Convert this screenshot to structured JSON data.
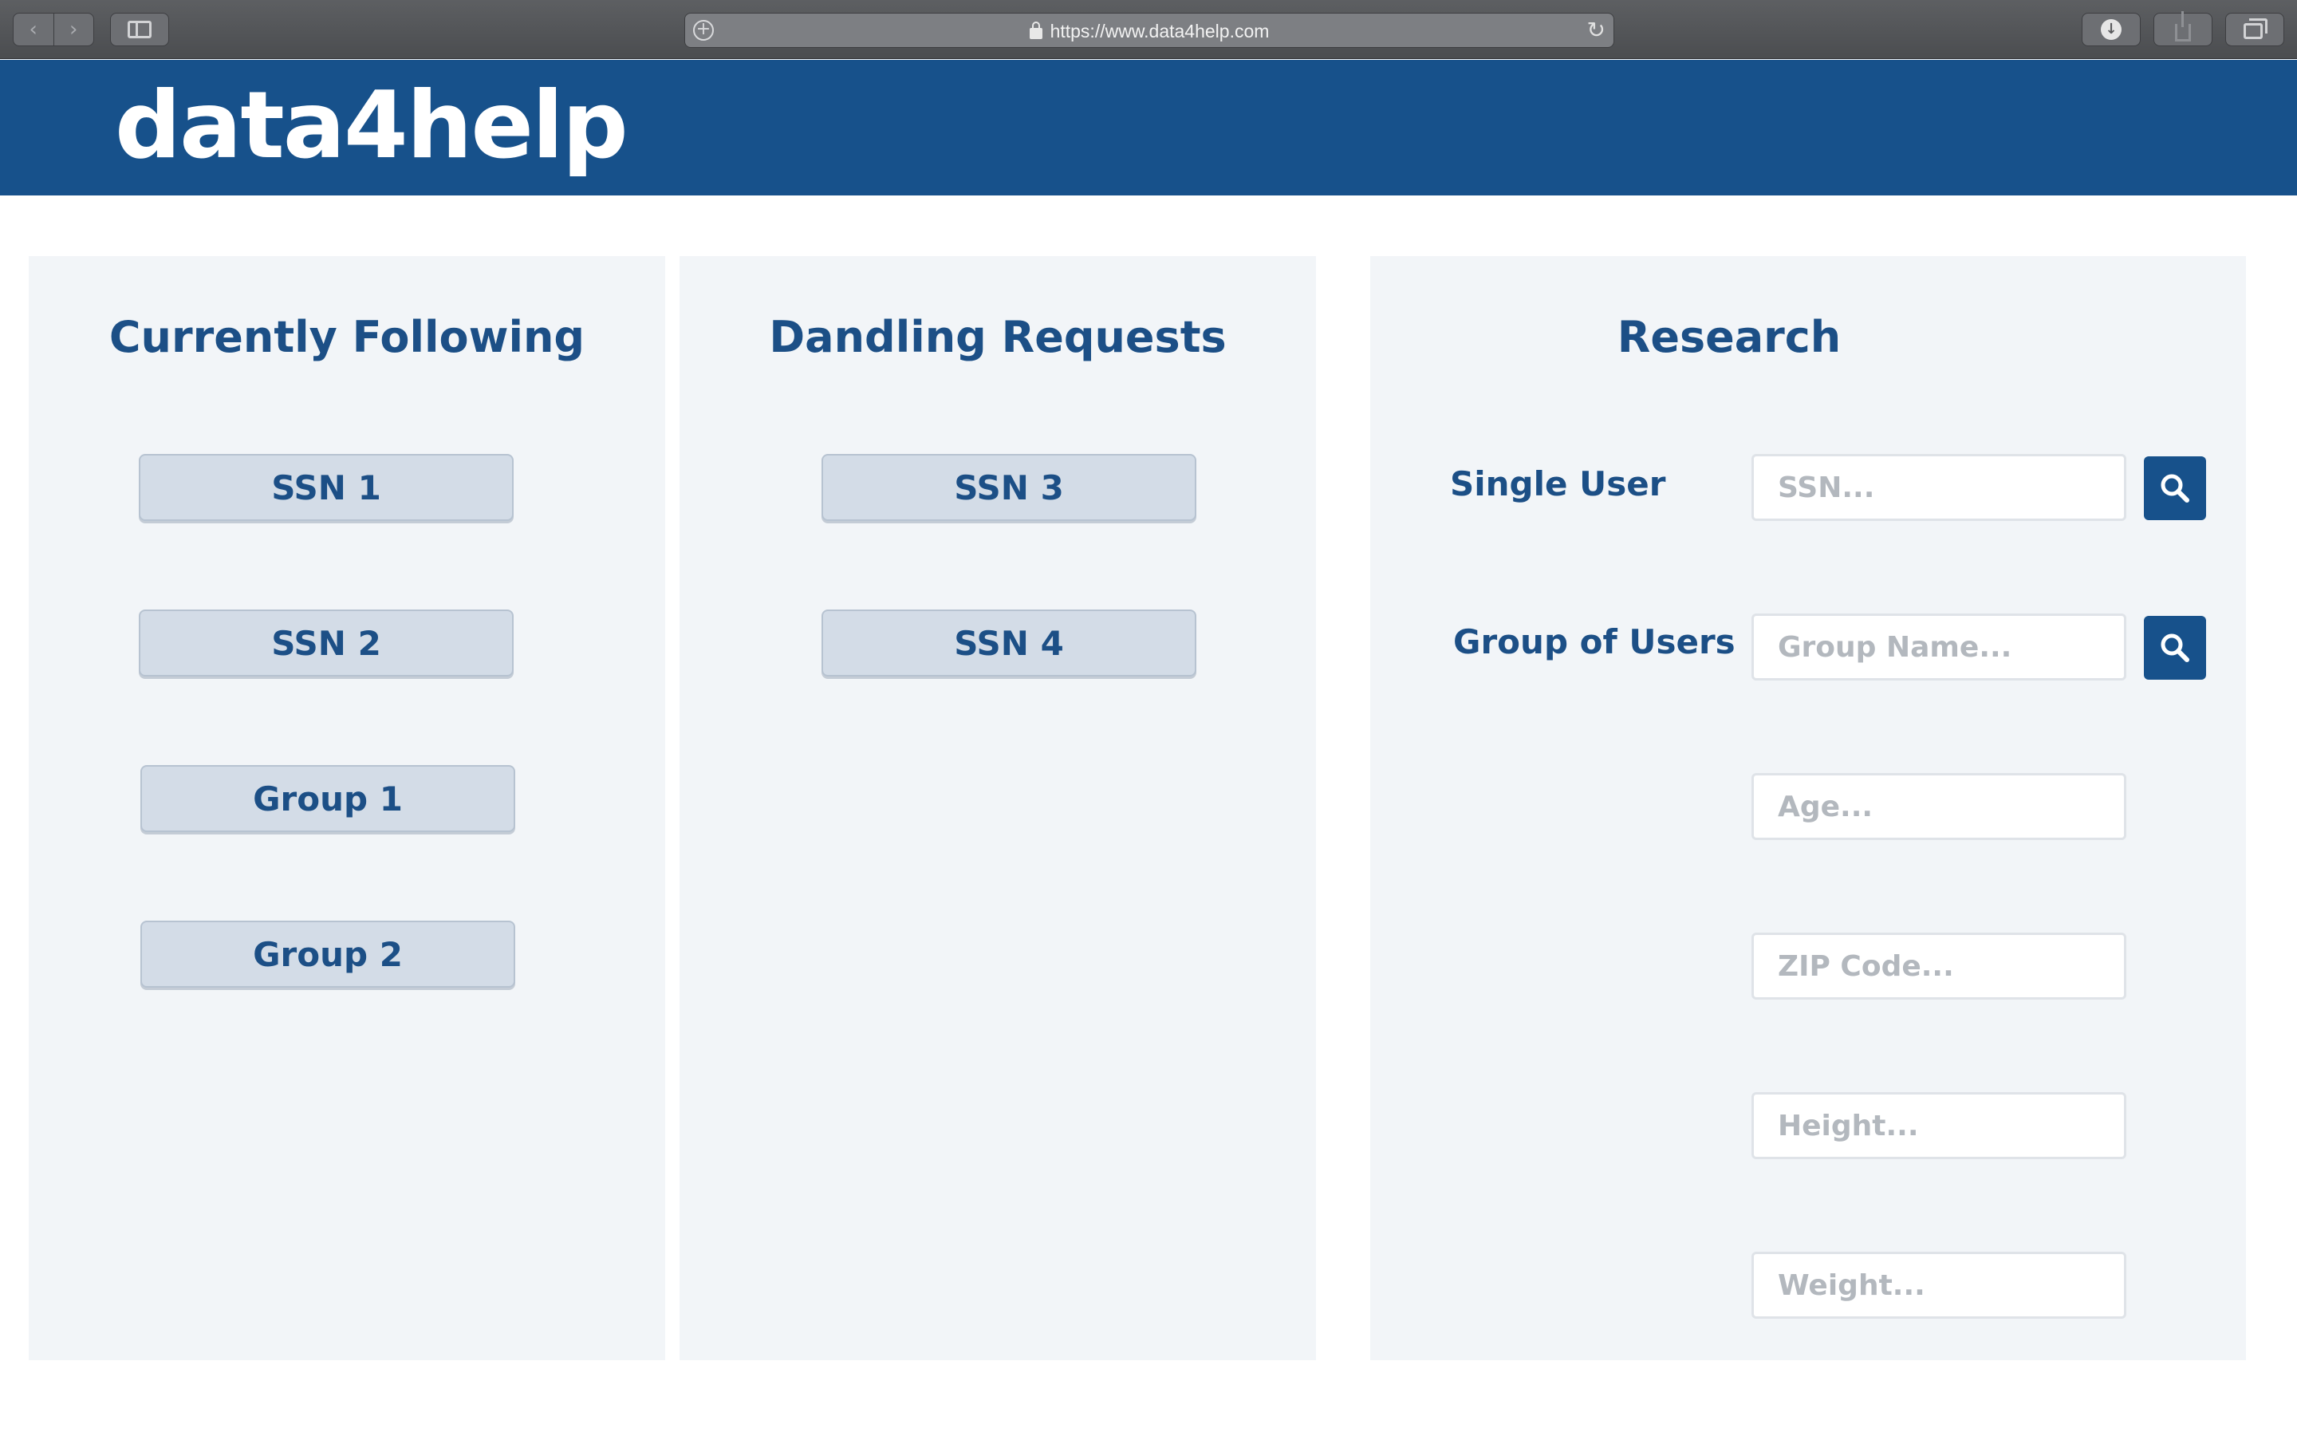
{
  "browser": {
    "url": "https://www.data4help.com",
    "icons": {
      "back": "chevron-left-icon",
      "forward": "chevron-right-icon",
      "sidebar": "sidebar-icon",
      "reload": "reload-icon",
      "download": "download-icon",
      "share": "share-icon",
      "tabs": "tabs-icon"
    }
  },
  "header": {
    "logo": "data4help",
    "background_color": "#17518b"
  },
  "following": {
    "title": "Currently Following",
    "items": [
      "SSN 1",
      "SSN 2",
      "Group 1",
      "Group 2"
    ]
  },
  "dangling": {
    "title": "Dandling Requests",
    "items": [
      "SSN 3",
      "SSN 4"
    ]
  },
  "research": {
    "title": "Research",
    "single_user_label": "Single User",
    "group_label": "Group of Users",
    "placeholders": {
      "ssn": "SSN...",
      "group_name": "Group Name...",
      "age": "Age...",
      "zip": "ZIP Code...",
      "height": "Height...",
      "weight": "Weight..."
    }
  },
  "colors": {
    "accent": "#1c4f86",
    "panel_bg": "#f2f5f8",
    "pill_bg": "#d3dce7"
  }
}
